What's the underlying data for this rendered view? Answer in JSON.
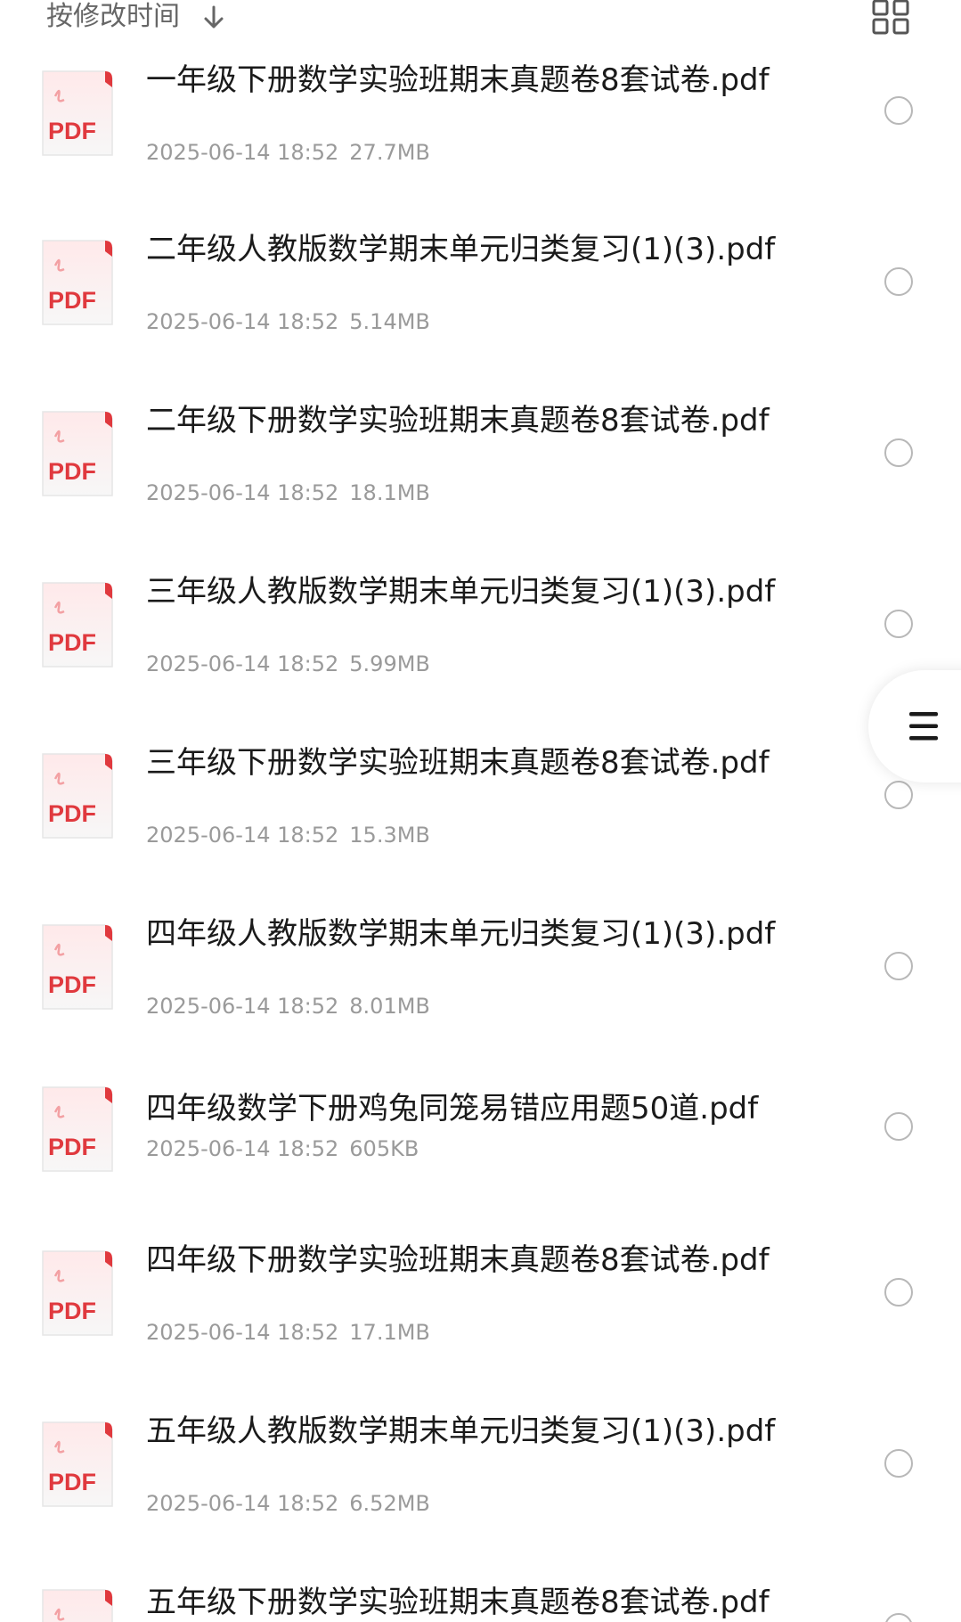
{
  "sort_bar": {
    "label": "按修改时间",
    "direction_icon": "arrow-down-icon",
    "view_toggle_icon": "grid-view-icon"
  },
  "icons": {
    "file_type_label": "PDF",
    "accent": "#e0393e",
    "side_handle_icon": "menu-icon"
  },
  "files": [
    {
      "name": "一年级下册数学实验班期末真题卷8套试卷.pdf",
      "date": "2025-06-14 18:52",
      "size": "27.7MB"
    },
    {
      "name": "二年级人教版数学期末单元归类复习(1)(3).pdf",
      "date": "2025-06-14 18:52",
      "size": "5.14MB"
    },
    {
      "name": "二年级下册数学实验班期末真题卷8套试卷.pdf",
      "date": "2025-06-14 18:52",
      "size": "18.1MB"
    },
    {
      "name": "三年级人教版数学期末单元归类复习(1)(3).pdf",
      "date": "2025-06-14 18:52",
      "size": "5.99MB"
    },
    {
      "name": "三年级下册数学实验班期末真题卷8套试卷.pdf",
      "date": "2025-06-14 18:52",
      "size": "15.3MB"
    },
    {
      "name": "四年级人教版数学期末单元归类复习(1)(3).pdf",
      "date": "2025-06-14 18:52",
      "size": "8.01MB"
    },
    {
      "name": "四年级数学下册鸡兔同笼易错应用题50道.pdf",
      "date": "2025-06-14 18:52",
      "size": "605KB"
    },
    {
      "name": "四年级下册数学实验班期末真题卷8套试卷.pdf",
      "date": "2025-06-14 18:52",
      "size": "17.1MB"
    },
    {
      "name": "五年级人教版数学期末单元归类复习(1)(3).pdf",
      "date": "2025-06-14 18:52",
      "size": "6.52MB"
    },
    {
      "name": "五年级下册数学实验班期末真题卷8套试卷.pdf",
      "date": "",
      "size": ""
    }
  ]
}
